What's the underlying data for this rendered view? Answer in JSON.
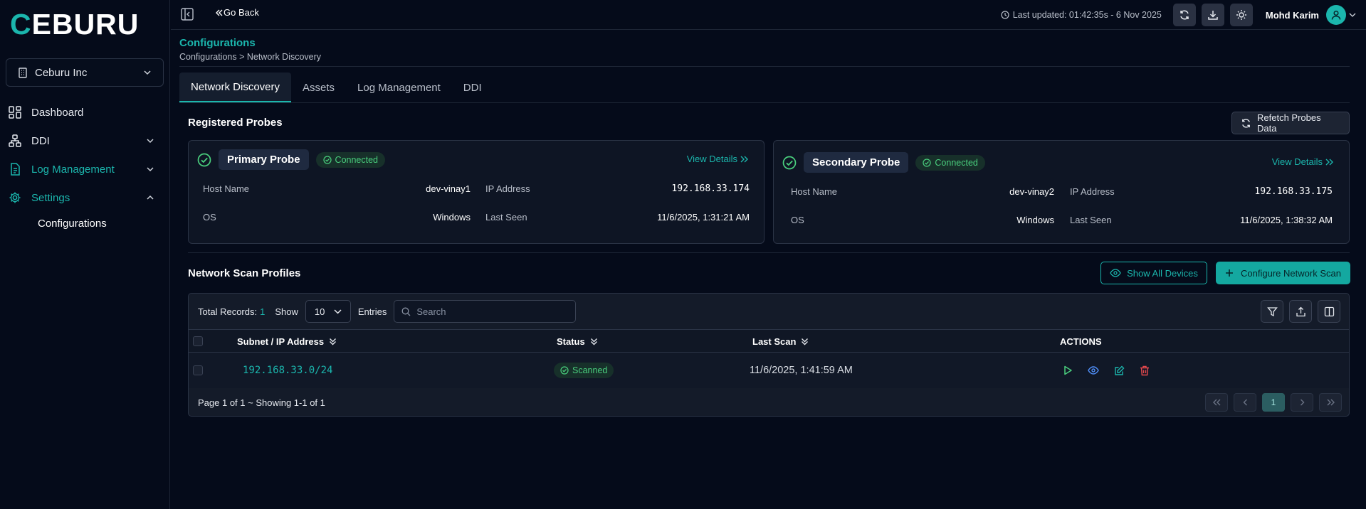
{
  "app": {
    "brand_first": "C",
    "brand_rest": "EBURU"
  },
  "sidebar": {
    "org": "Ceburu Inc",
    "items": [
      {
        "label": "Dashboard",
        "icon": "dashboard-icon"
      },
      {
        "label": "DDI",
        "icon": "network-icon"
      },
      {
        "label": "Log Management",
        "icon": "document-icon"
      },
      {
        "label": "Settings",
        "icon": "gear-icon"
      }
    ],
    "sub_items": [
      "Configurations"
    ]
  },
  "topbar": {
    "go_back": "Go Back",
    "last_updated": "Last updated: 01:42:35s - 6 Nov 2025",
    "user_name": "Mohd Karim"
  },
  "page": {
    "title": "Configurations",
    "breadcrumb": "Configurations > Network Discovery",
    "tabs": [
      "Network Discovery",
      "Assets",
      "Log Management",
      "DDI"
    ]
  },
  "probes": {
    "section_title": "Registered Probes",
    "refetch_label": "Refetch Probes Data",
    "host_label": "Host Name",
    "ip_label": "IP Address",
    "os_label": "OS",
    "last_seen_label": "Last Seen",
    "view_details": "View Details",
    "items": [
      {
        "name": "Primary Probe",
        "status": "Connected",
        "host": "dev-vinay1",
        "ip": "192.168.33.174",
        "os": "Windows",
        "last_seen": "11/6/2025, 1:31:21 AM"
      },
      {
        "name": "Secondary Probe",
        "status": "Connected",
        "host": "dev-vinay2",
        "ip": "192.168.33.175",
        "os": "Windows",
        "last_seen": "11/6/2025, 1:38:32 AM"
      }
    ]
  },
  "scan": {
    "section_title": "Network Scan Profiles",
    "show_all_label": "Show All Devices",
    "configure_label": "Configure Network Scan",
    "total_label": "Total Records:",
    "total": "1",
    "show_label": "Show",
    "show_value": "10",
    "entries_label": "Entries",
    "search_placeholder": "Search",
    "columns": [
      "Subnet / IP Address",
      "Status",
      "Last Scan",
      "ACTIONS"
    ],
    "rows": [
      {
        "subnet": "192.168.33.0/24",
        "status": "Scanned",
        "last_scan": "11/6/2025, 1:41:59 AM"
      }
    ],
    "footer": "Page 1 of 1 ~ Showing 1-1 of 1",
    "current_page": "1"
  },
  "colors": {
    "accent": "#1bb6ad",
    "success": "#4ad07e",
    "danger": "#e5484d",
    "info": "#4f8df5",
    "bg": "#050b1a"
  }
}
